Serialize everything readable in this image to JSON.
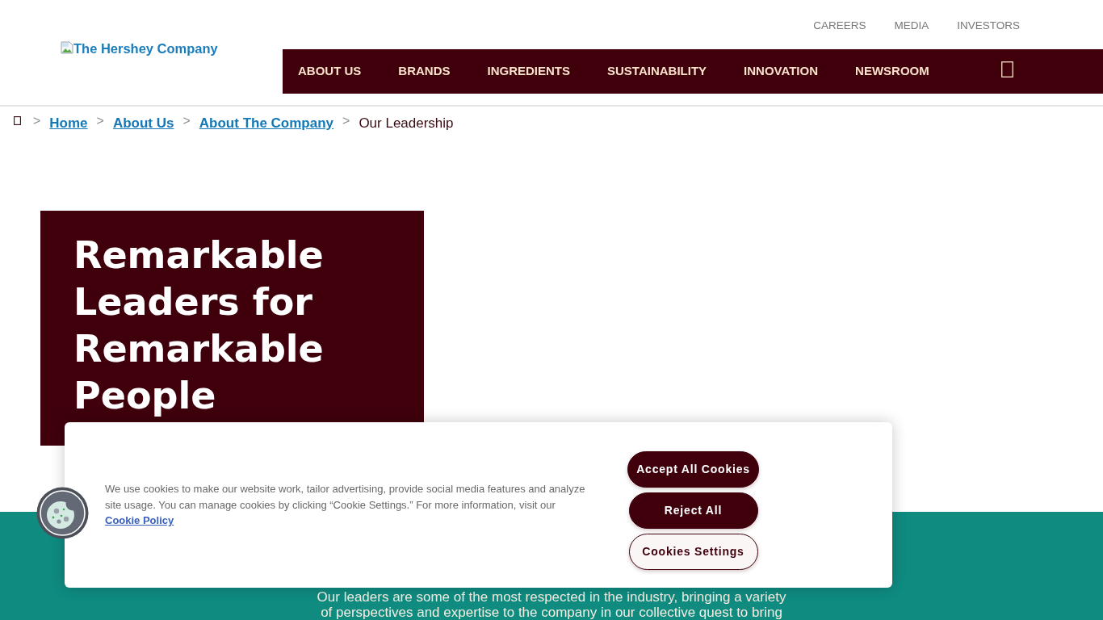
{
  "header": {
    "logo_alt": "The Hershey Company",
    "utility_links": [
      "CAREERS",
      "MEDIA",
      "INVESTORS"
    ],
    "nav": [
      "ABOUT US",
      "BRANDS",
      "INGREDIENTS",
      "SUSTAINABILITY",
      "INNOVATION",
      "NEWSROOM"
    ]
  },
  "breadcrumb": [
    {
      "separator": ">",
      "label": "Home",
      "kind": "link"
    },
    {
      "separator": ">",
      "label": "About Us",
      "kind": "link"
    },
    {
      "separator": ">",
      "label": "About The Company",
      "kind": "link"
    },
    {
      "separator": ">",
      "label": "Our Leadership",
      "kind": "current"
    }
  ],
  "hero": {
    "title": "Remarkable Leaders for Remarkable People"
  },
  "intro": {
    "text": "Our leaders are some of the most respected in the industry, bringing a variety of perspectives and expertise to the company in our collective quest to bring"
  },
  "cookie_banner": {
    "message": "We use cookies to make our website work, tailor advertising, provide social media features and analyze site usage. You can manage cookies by clicking “Cookie Settings.” For more information, visit our",
    "policy_link": "Cookie Policy",
    "buttons": [
      {
        "label": "Accept All Cookies",
        "kind": "primary"
      },
      {
        "label": "Reject All",
        "kind": "primary"
      },
      {
        "label": "Cookies Settings",
        "kind": "outline"
      }
    ]
  }
}
